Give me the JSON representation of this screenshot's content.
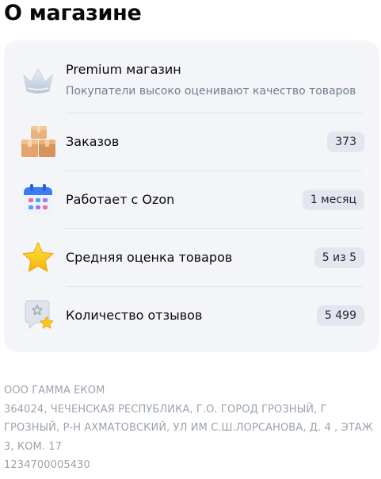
{
  "page": {
    "title": "О магазине"
  },
  "rows": [
    {
      "label": "Premium магазин",
      "sub": "Покупатели высоко оценивают качество товаров",
      "icon": "crown-icon"
    },
    {
      "label": "Заказов",
      "value": "373",
      "icon": "boxes-icon"
    },
    {
      "label": "Работает с Ozon",
      "value": "1 месяц",
      "icon": "calendar-icon"
    },
    {
      "label": "Средняя оценка товаров",
      "value": "5 из 5",
      "icon": "star-icon"
    },
    {
      "label": "Количество отзывов",
      "value": "5 499",
      "icon": "review-bubble-icon"
    }
  ],
  "legal": {
    "company": "ООО ГАММА ЕКОМ",
    "address": "364024, ЧЕЧЕНСКАЯ РЕСПУБЛИКА, Г.О. ГОРОД ГРОЗНЫЙ, Г ГРОЗНЫЙ, Р-Н АХМАТОВСКИЙ, УЛ ИМ С.Ш.ЛОРСАНОВА, Д. 4 , ЭТАЖ 3, КОМ. 17",
    "ogrn": "1234700005430"
  },
  "colors": {
    "card_bg": "#f4f5f8",
    "badge_bg": "#e3e6ee",
    "muted_text": "#707f8d",
    "legal_text": "#9aa3ae"
  }
}
